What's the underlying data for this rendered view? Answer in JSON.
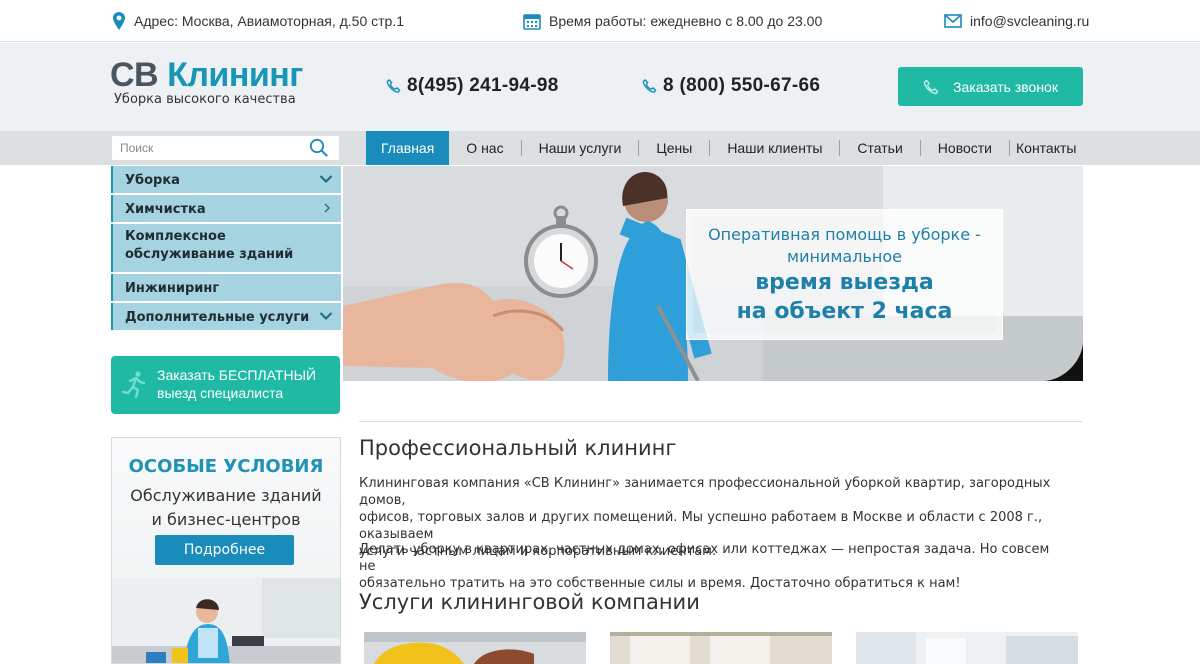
{
  "topbar": {
    "address": "Адрес: Москва, Авиамоторная, д.50 стр.1",
    "hours": "Время работы: ежедневно с 8.00 до 23.00",
    "email": "info@svcleaning.ru"
  },
  "header": {
    "logo_part1": "СВ",
    "logo_part2": "Клининг",
    "slogan": "Уборка высокого качества",
    "phone1": "8(495) 241-94-98",
    "phone2": "8 (800) 550-67-66",
    "call_button": "Заказать звонок"
  },
  "search": {
    "placeholder": "Поиск"
  },
  "nav": {
    "items": [
      "Главная",
      "О нас",
      "Наши услуги",
      "Цены",
      "Наши клиенты",
      "Статьи",
      "Новости",
      "Контакты"
    ],
    "active": "Главная"
  },
  "sidebar": {
    "items": [
      {
        "label": "Уборка",
        "icon": "chevron-down-icon"
      },
      {
        "label": "Химчистка",
        "icon": "chevron-right-icon"
      },
      {
        "label": "Комплексное обслуживание зданий",
        "icon": ""
      },
      {
        "label": "Инжиниринг",
        "icon": ""
      },
      {
        "label": "Дополнительные услуги",
        "icon": "chevron-down-icon"
      }
    ],
    "free_button_line1": "Заказать БЕСПЛАТНЫЙ",
    "free_button_line2": "выезд специалиста",
    "promo": {
      "title": "ОСОБЫЕ УСЛОВИЯ",
      "line1": "Обслуживание зданий",
      "line2": "и бизнес-центров",
      "button": "Подробнее"
    }
  },
  "banner": {
    "line1": "Оперативная помощь в уборке -",
    "line2": "минимальное",
    "line3": "время выезда",
    "line4": "на объект 2 часа"
  },
  "content": {
    "title": "Профессиональный клининг",
    "para1_l1": "Клининговая компания «СВ Клининг» занимается профессиональной уборкой квартир, загородных домов,",
    "para1_l2": "офисов, торговых залов и других помещений. Мы успешно работаем в Москве и области с 2008 г., оказываем",
    "para1_l3": "услуги частным лицам и корпоративным клиентам.",
    "para2_l1": "Делать уборку в квартирах, частных домах, офисах или коттеджах — непростая задача. Но совсем не",
    "para2_l2": "обязательно тратить на это собственные силы и время. Достаточно обратиться к нам!",
    "services_title": "Услуги клининговой компании"
  },
  "colors": {
    "accent_teal": "#20b9a4",
    "accent_blue": "#1a8cbb",
    "sidebar_bg": "#a5d3df",
    "navbar_bg": "#dcdfe1",
    "header_bg": "#eef1f3"
  }
}
